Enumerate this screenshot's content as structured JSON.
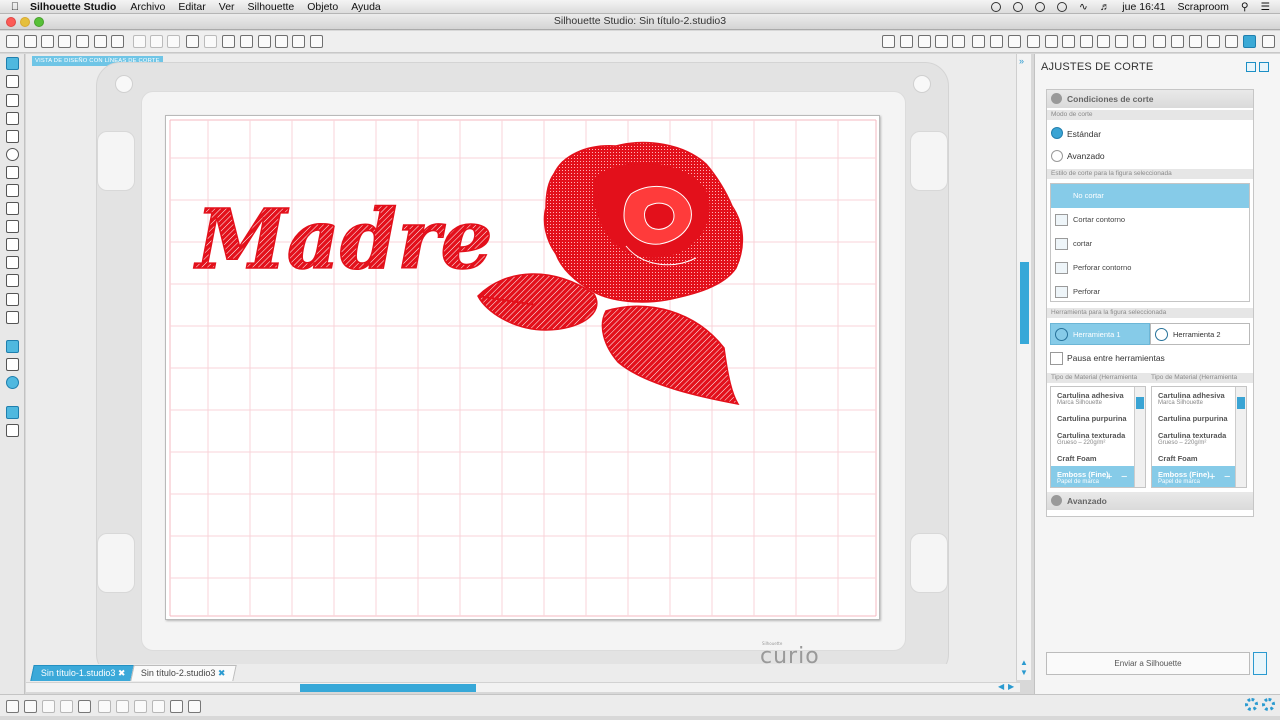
{
  "menubar": {
    "app": "Silhouette Studio",
    "items": [
      "Archivo",
      "Editar",
      "Ver",
      "Silhouette",
      "Objeto",
      "Ayuda"
    ],
    "clock": "jue 16:41",
    "user": "Scraproom"
  },
  "window": {
    "title": "Silhouette Studio: Sin título-2.studio3"
  },
  "canvas": {
    "view_label": "VISTA DE DISEÑO CON LÍNEAS DE CORTE",
    "design_text": "Madre",
    "brand_small": "Silhouette",
    "brand": "curio"
  },
  "tabs": [
    {
      "label": "Sin título-1.studio3",
      "active": true
    },
    {
      "label": "Sin título-2.studio3",
      "active": false
    }
  ],
  "panel": {
    "title": "AJUSTES DE CORTE",
    "conditions": {
      "header": "Condiciones de corte",
      "mode_label": "Modo de corte",
      "mode_options": [
        {
          "label": "Estándar",
          "checked": true
        },
        {
          "label": "Avanzado",
          "checked": false
        }
      ],
      "style_label": "Estilo de corte para la figura seleccionada",
      "style_options": [
        {
          "label": "No cortar",
          "selected": true
        },
        {
          "label": "Cortar contorno",
          "selected": false
        },
        {
          "label": "cortar",
          "selected": false
        },
        {
          "label": "Perforar contorno",
          "selected": false
        },
        {
          "label": "Perforar",
          "selected": false
        }
      ],
      "tool_label": "Herramienta para la figura seleccionada",
      "tools": [
        {
          "label": "Herramienta 1",
          "selected": true
        },
        {
          "label": "Herramienta 2",
          "selected": false
        }
      ],
      "pause_label": "Pausa entre herramientas",
      "material_label_1": "Tipo de Material (Herramienta",
      "material_label_2": "Tipo de Material (Herramienta",
      "materials": [
        {
          "name": "Cartulina adhesiva",
          "sub": "Marca Silhouette"
        },
        {
          "name": "Cartulina purpurina",
          "sub": ""
        },
        {
          "name": "Cartulina texturada",
          "sub": "Grueso – 220g/m²"
        },
        {
          "name": "Craft Foam",
          "sub": ""
        },
        {
          "name": "Emboss (Fine)",
          "sub": "Papel de marca"
        }
      ]
    },
    "advanced": {
      "header": "Avanzado"
    },
    "send_button": "Enviar a Silhouette"
  },
  "colors": {
    "accent": "#3aa9d9",
    "design_red": "#e3101b",
    "grid_line": "#f3a7b2"
  },
  "icons": {
    "toolbar": [
      "new-icon",
      "open-icon",
      "open-library-icon",
      "save-icon",
      "save-as-icon",
      "save-selection-icon",
      "print-icon",
      "send-icon",
      "copy-icon",
      "paste-icon",
      "cut-icon",
      "undo-icon",
      "redo-icon",
      "pan-icon",
      "zoom-in-icon",
      "zoom-out-icon",
      "zoom-box-icon",
      "zoom-drag-icon",
      "fit-icon"
    ],
    "left": [
      "select-icon",
      "point-edit-icon",
      "line-icon",
      "rectangle-icon",
      "rounded-rect-icon",
      "ellipse-icon",
      "polygon-icon",
      "curve-icon",
      "freehand-icon",
      "smooth-freehand-icon",
      "arc-icon",
      "regular-polygon-icon",
      "text-icon",
      "eraser-icon",
      "knife-icon",
      "design-page-icon",
      "library-icon",
      "store-icon",
      "ruler-icon",
      "layout-icon"
    ]
  }
}
